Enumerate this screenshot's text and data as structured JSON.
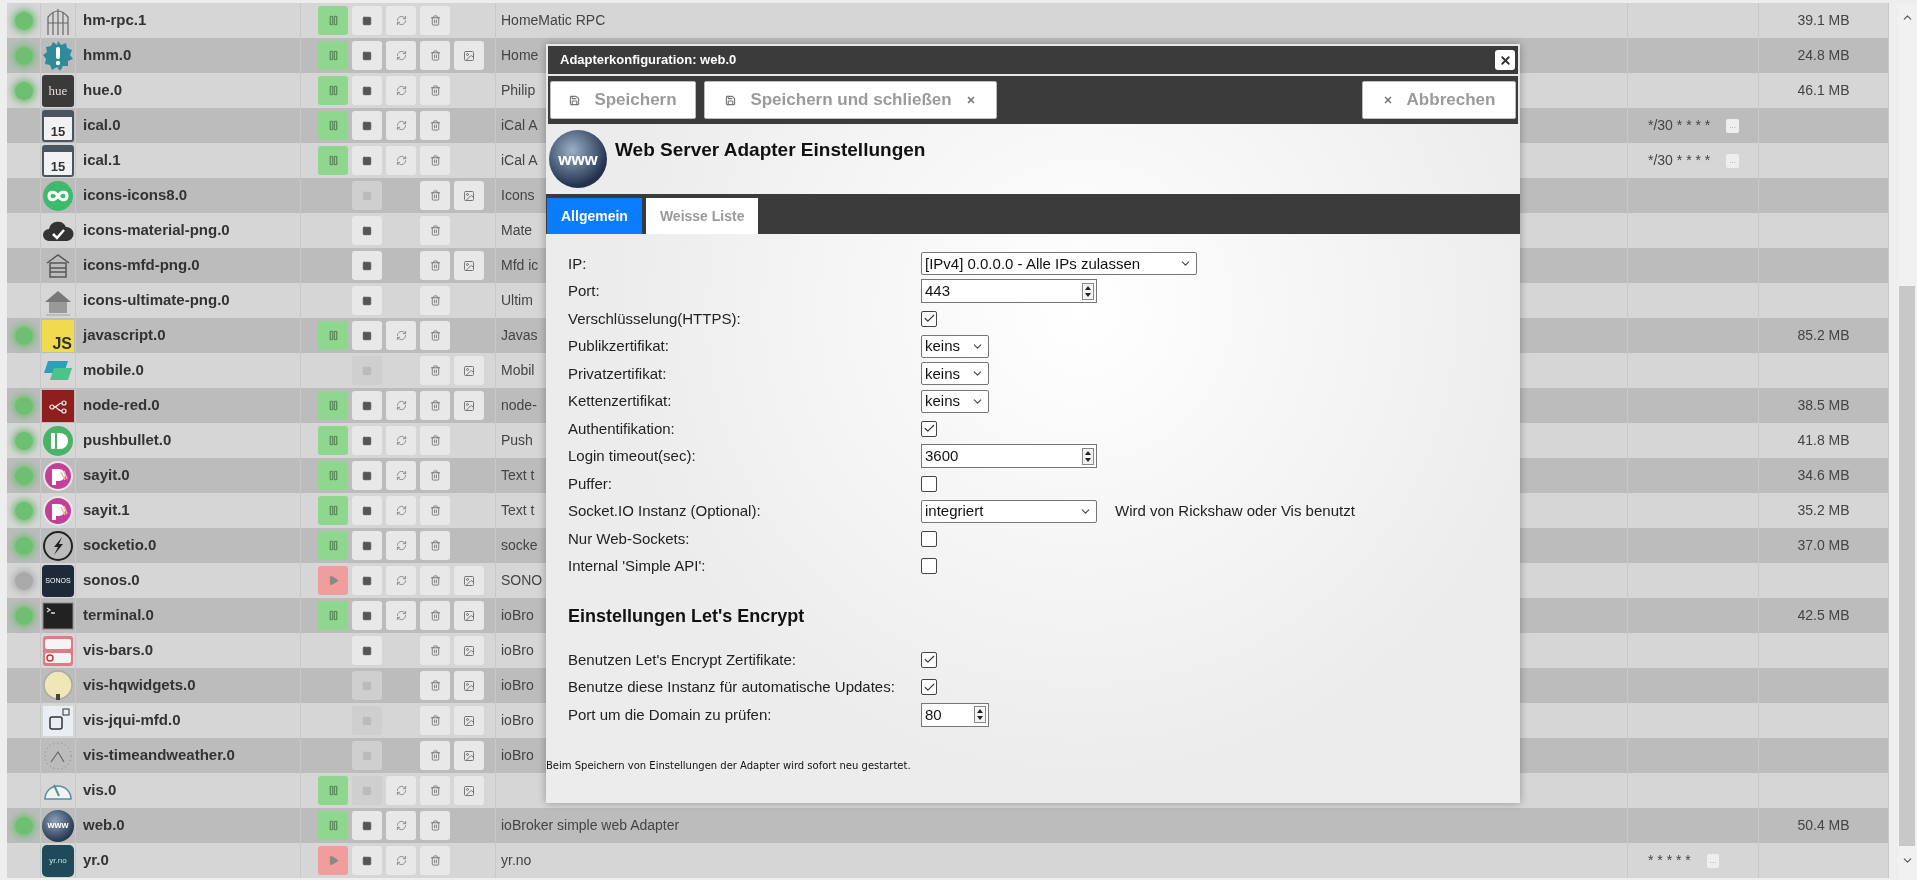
{
  "table": {
    "rows": [
      {
        "status": {
          "kind": "running"
        },
        "logo": {
          "kind": "arch"
        },
        "name": "hm-rpc.1",
        "run": {
          "kind": "pause"
        },
        "restart": true,
        "stop_enabled": true,
        "image": false,
        "description": "HomeMatic RPC",
        "memory": "39.1 MB"
      },
      {
        "status": {
          "kind": "running"
        },
        "logo": {
          "kind": "alert"
        },
        "name": "hmm.0",
        "run": {
          "kind": "pause"
        },
        "restart": true,
        "stop_enabled": true,
        "image": true,
        "description": "Home",
        "memory": "24.8 MB"
      },
      {
        "status": {
          "kind": "running"
        },
        "logo": {
          "kind": "hue",
          "text": "hue"
        },
        "name": "hue.0",
        "run": {
          "kind": "pause"
        },
        "restart": true,
        "stop_enabled": true,
        "image": false,
        "description": "Philip",
        "memory": "46.1 MB"
      },
      {
        "logo": {
          "kind": "calendar",
          "text": "15"
        },
        "name": "ical.0",
        "run": {
          "kind": "pause"
        },
        "restart": true,
        "stop_enabled": true,
        "image": false,
        "description": "iCal A",
        "schedule": "*/30 * * * *",
        "schedule_button": "..."
      },
      {
        "logo": {
          "kind": "calendar",
          "text": "15"
        },
        "name": "ical.1",
        "run": {
          "kind": "pause"
        },
        "restart": true,
        "stop_enabled": true,
        "image": false,
        "description": "iCal A",
        "schedule": "*/30 * * * *",
        "schedule_button": "..."
      },
      {
        "logo": {
          "kind": "infinity"
        },
        "name": "icons-icons8.0",
        "restart": false,
        "stop_enabled": false,
        "image": true,
        "description": "Icons"
      },
      {
        "logo": {
          "kind": "cloud-check"
        },
        "name": "icons-material-png.0",
        "restart": false,
        "stop_enabled": true,
        "image": false,
        "description": "Mate"
      },
      {
        "logo": {
          "kind": "garage"
        },
        "name": "icons-mfd-png.0",
        "restart": false,
        "stop_enabled": true,
        "image": true,
        "description": "Mfd ic"
      },
      {
        "logo": {
          "kind": "house"
        },
        "name": "icons-ultimate-png.0",
        "restart": false,
        "stop_enabled": true,
        "image": false,
        "description": "Ultim"
      },
      {
        "status": {
          "kind": "running"
        },
        "logo": {
          "kind": "js",
          "text": "JS"
        },
        "name": "javascript.0",
        "run": {
          "kind": "pause"
        },
        "restart": true,
        "stop_enabled": true,
        "image": false,
        "description": "Javas",
        "memory": "85.2 MB"
      },
      {
        "logo": {
          "kind": "tiles"
        },
        "name": "mobile.0",
        "restart": false,
        "stop_enabled": false,
        "image": true,
        "description": "Mobil"
      },
      {
        "status": {
          "kind": "running"
        },
        "logo": {
          "kind": "flow"
        },
        "name": "node-red.0",
        "run": {
          "kind": "pause"
        },
        "restart": true,
        "stop_enabled": true,
        "image": true,
        "description": "node-",
        "memory": "38.5 MB"
      },
      {
        "status": {
          "kind": "running"
        },
        "logo": {
          "kind": "pushbullet"
        },
        "name": "pushbullet.0",
        "run": {
          "kind": "pause"
        },
        "restart": true,
        "stop_enabled": true,
        "image": false,
        "description": "Push",
        "memory": "41.8 MB"
      },
      {
        "status": {
          "kind": "running"
        },
        "logo": {
          "kind": "speaker"
        },
        "name": "sayit.0",
        "run": {
          "kind": "pause"
        },
        "restart": true,
        "stop_enabled": true,
        "image": false,
        "description": "Text t",
        "memory": "34.6 MB"
      },
      {
        "status": {
          "kind": "running"
        },
        "logo": {
          "kind": "speaker"
        },
        "name": "sayit.1",
        "run": {
          "kind": "pause"
        },
        "restart": true,
        "stop_enabled": true,
        "image": false,
        "description": "Text t",
        "memory": "35.2 MB"
      },
      {
        "status": {
          "kind": "running"
        },
        "logo": {
          "kind": "bolt"
        },
        "name": "socketio.0",
        "run": {
          "kind": "pause"
        },
        "restart": true,
        "stop_enabled": true,
        "image": false,
        "description": "socke",
        "memory": "37.0 MB"
      },
      {
        "status": {
          "kind": "stopped"
        },
        "logo": {
          "kind": "sonos",
          "text": "SONOS"
        },
        "name": "sonos.0",
        "run": {
          "kind": "play"
        },
        "restart": true,
        "stop_enabled": true,
        "image": true,
        "description": "SONO"
      },
      {
        "status": {
          "kind": "running"
        },
        "logo": {
          "kind": "terminal"
        },
        "name": "terminal.0",
        "run": {
          "kind": "pause"
        },
        "restart": true,
        "stop_enabled": true,
        "image": true,
        "description": "ioBro",
        "memory": "42.5 MB"
      },
      {
        "logo": {
          "kind": "bars"
        },
        "name": "vis-bars.0",
        "restart": false,
        "stop_enabled": true,
        "image": true,
        "description": "ioBro"
      },
      {
        "logo": {
          "kind": "bulb"
        },
        "name": "vis-hqwidgets.0",
        "restart": false,
        "stop_enabled": false,
        "image": true,
        "description": "ioBro"
      },
      {
        "logo": {
          "kind": "socket"
        },
        "name": "vis-jqui-mfd.0",
        "restart": false,
        "stop_enabled": false,
        "image": true,
        "description": "ioBro"
      },
      {
        "logo": {
          "kind": "dial"
        },
        "name": "vis-timeandweather.0",
        "restart": false,
        "stop_enabled": false,
        "image": true,
        "description": "ioBro"
      },
      {
        "logo": {
          "kind": "gauge"
        },
        "name": "vis.0",
        "run": {
          "kind": "pause"
        },
        "restart": true,
        "stop_enabled": false,
        "image": true
      },
      {
        "status": {
          "kind": "running"
        },
        "logo": {
          "kind": "globe",
          "text": "www"
        },
        "name": "web.0",
        "run": {
          "kind": "pause"
        },
        "restart": true,
        "stop_enabled": true,
        "image": false,
        "description": "ioBroker simple web Adapter",
        "memory": "50.4 MB"
      },
      {
        "logo": {
          "kind": "yr",
          "text": "yr.no"
        },
        "name": "yr.0",
        "run": {
          "kind": "play"
        },
        "restart": true,
        "stop_enabled": true,
        "image": false,
        "description": "yr.no",
        "schedule": "* * * * *",
        "schedule_button": "..."
      }
    ]
  },
  "dialog": {
    "title": "Adapterkonfiguration: web.0",
    "toolbar": [
      {
        "kind": "save",
        "label": "Speichern"
      },
      {
        "kind": "save-close",
        "label": "Speichern und schließen"
      },
      {
        "kind": "cancel",
        "label": "Abbrechen"
      }
    ],
    "logo_text": "www",
    "heading": "Web Server Adapter Einstellungen",
    "tabs": [
      {
        "label": "Allgemein",
        "selected": true
      },
      {
        "label": "Weisse Liste",
        "selected": false
      }
    ],
    "fields": [
      {
        "label": "IP:",
        "kind": "select",
        "value": "[IPv4] 0.0.0.0 - Alle IPs zulassen"
      },
      {
        "label": "Port:",
        "kind": "number",
        "value": "443"
      },
      {
        "label": "Verschlüsselung(HTTPS):",
        "kind": "checkbox",
        "checked": true
      },
      {
        "label": "Publikzertifikat:",
        "kind": "select",
        "value": "keins"
      },
      {
        "label": "Privatzertifikat:",
        "kind": "select",
        "value": "keins"
      },
      {
        "label": "Kettenzertifikat:",
        "kind": "select",
        "value": "keins"
      },
      {
        "label": "Authentifikation:",
        "kind": "checkbox",
        "checked": true
      },
      {
        "label": "Login timeout(sec):",
        "kind": "number",
        "value": "3600"
      },
      {
        "label": "Puffer:",
        "kind": "checkbox",
        "checked": false
      },
      {
        "label": "Socket.IO Instanz (Optional):",
        "kind": "select",
        "value": "integriert",
        "hint": "Wird von Rickshaw oder Vis benutzt"
      },
      {
        "label": "Nur Web-Sockets:",
        "kind": "checkbox",
        "checked": false
      },
      {
        "label": "Internal 'Simple API':",
        "kind": "checkbox",
        "checked": false
      }
    ],
    "section_title": "Einstellungen Let's Encrypt",
    "le_fields": [
      {
        "label": "Benutzen Let's Encrypt Zertifikate:",
        "kind": "checkbox",
        "checked": true
      },
      {
        "label": "Benutze diese Instanz für automatische Updates:",
        "kind": "checkbox",
        "checked": true
      },
      {
        "label": "Port um die Domain zu prüfen:",
        "kind": "number",
        "value": "80"
      }
    ],
    "footer": "Beim Speichern von Einstellungen der Adapter wird sofort neu gestartet."
  }
}
